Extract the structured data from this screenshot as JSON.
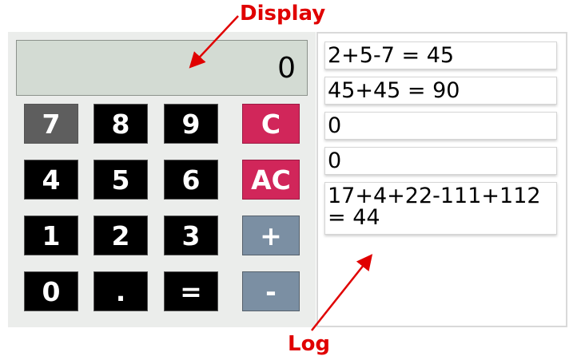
{
  "calculator": {
    "display_value": "0",
    "keys": {
      "k7": "7",
      "k8": "8",
      "k9": "9",
      "clear": "C",
      "k4": "4",
      "k5": "5",
      "k6": "6",
      "all_clear": "AC",
      "k1": "1",
      "k2": "2",
      "k3": "3",
      "plus": "+",
      "k0": "0",
      "dot": ".",
      "equals": "=",
      "minus": "-"
    },
    "colors": {
      "number_key": "#000000",
      "hovered_key": "#5e5e5e",
      "clear_key": "#d1265a",
      "operator_key": "#7b8fa3",
      "display_bg": "#d3dbd3"
    }
  },
  "log": {
    "entries": [
      "2+5-7 = 45",
      "45+45 = 90",
      "0",
      "0",
      "17+4+22-111+112 = 44"
    ]
  },
  "annotations": {
    "display_label": "Display",
    "log_label": "Log",
    "color": "#e00000"
  }
}
